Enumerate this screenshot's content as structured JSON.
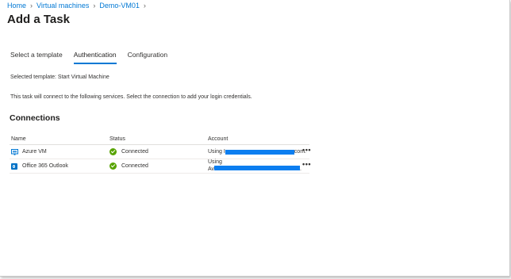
{
  "breadcrumb": {
    "items": [
      "Home",
      "Virtual machines",
      "Demo-VM01"
    ]
  },
  "page_title": "Add a Task",
  "tabs": [
    {
      "label": "Select a template",
      "active": false
    },
    {
      "label": "Authentication",
      "active": true
    },
    {
      "label": "Configuration",
      "active": false
    }
  ],
  "selected_template_text": "Selected template: Start Virtual Machine",
  "description_text": "This task will connect to the following services. Select the connection to add your login credentials.",
  "connections": {
    "title": "Connections",
    "columns": [
      "Name",
      "Status",
      "Account"
    ],
    "rows": [
      {
        "name": "Azure VM",
        "icon": "azure-vm-icon",
        "status": "Connected",
        "account_prefix": "Using I",
        "account_suffix": "com.",
        "more": "•••"
      },
      {
        "name": "Office 365 Outlook",
        "icon": "outlook-icon",
        "status": "Connected",
        "account_prefix": "Using",
        "account_line2_prefix": "Av",
        "account_suffix": ".",
        "more": "•••"
      }
    ]
  },
  "colors": {
    "accent": "#0078d4",
    "status_ok": "#57a300",
    "redaction": "#0c7ef0"
  }
}
